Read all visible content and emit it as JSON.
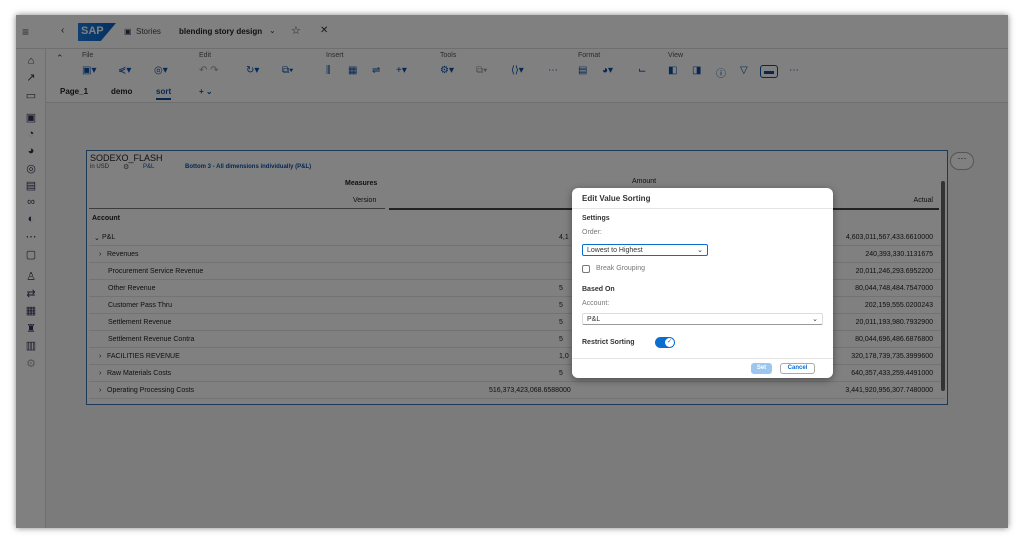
{
  "shell": {
    "logo": "SAP",
    "stories": "Stories",
    "story_title": "blending story design"
  },
  "toolbar": {
    "groups": [
      "File",
      "Edit",
      "Insert",
      "Tools",
      "Format",
      "View"
    ]
  },
  "pages": [
    "Page_1",
    "demo",
    "sort"
  ],
  "widget": {
    "title": "SODEXO_FLASH",
    "currency": "in USD",
    "filter": "P&L",
    "ranking": "Bottom 3 - All dimensions individually (P&L)",
    "measures_label": "Measures",
    "measures_value": "Amount",
    "version_label": "Version",
    "version_value": "Actual",
    "account_label": "Account",
    "rows": [
      {
        "label": "P&L",
        "expand": "open",
        "mid": "4,1",
        "actual": "4,603,011,567,433.6610000"
      },
      {
        "label": "Revenues",
        "expand": "closed",
        "mid": "",
        "actual": "240,393,330.1131675"
      },
      {
        "label": "Procurement Service Revenue",
        "expand": "",
        "mid": "",
        "actual": "20,011,246,293.6952200"
      },
      {
        "label": "Other Revenue",
        "expand": "",
        "mid": "5",
        "actual": "80,044,748,484.7547000"
      },
      {
        "label": "Customer Pass Thru",
        "expand": "",
        "mid": "5",
        "actual": "202,159,555.0200243"
      },
      {
        "label": "Settlement Revenue",
        "expand": "",
        "mid": "5",
        "actual": "20,011,193,980.7932900"
      },
      {
        "label": "Settlement Revenue Contra",
        "expand": "",
        "mid": "5",
        "actual": "80,044,696,486.6876800"
      },
      {
        "label": "FACILITIES REVENUE",
        "expand": "closed",
        "mid": "1,0",
        "actual": "320,178,739,735.3999600"
      },
      {
        "label": "Raw Materials Costs",
        "expand": "closed",
        "mid": "5",
        "actual": "640,357,433,259.4491000"
      },
      {
        "label": "Operating Processing Costs",
        "expand": "closed",
        "mid": "516,373,423,068.6588000",
        "actual": "3,441,920,956,307.7480000"
      }
    ]
  },
  "dialog": {
    "title": "Edit Value Sorting",
    "settings": "Settings",
    "order_label": "Order:",
    "order_value": "Lowest to Highest",
    "break_grouping": "Break Grouping",
    "break_grouping_checked": false,
    "based_on": "Based On",
    "account_label": "Account:",
    "account_value": "P&L",
    "restrict_sorting": "Restrict Sorting",
    "restrict_sorting_on": true,
    "set": "Set",
    "cancel": "Cancel"
  },
  "colors": {
    "accent": "#0a6ed1",
    "shell_blue": "#0a4fa3"
  }
}
